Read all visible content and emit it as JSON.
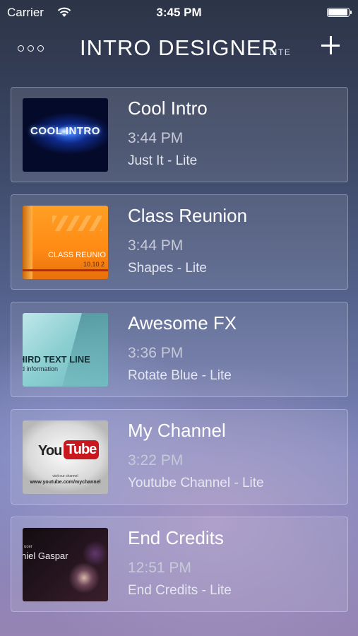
{
  "status_bar": {
    "carrier": "Carrier",
    "time": "3:45 PM",
    "battery_level": 0.95
  },
  "nav": {
    "title": "INTRO DESIGNER",
    "subtitle": "LITE",
    "more_icon": "more-icon",
    "add_icon": "plus-icon"
  },
  "projects": [
    {
      "title": "Cool Intro",
      "time": "3:44 PM",
      "template": "Just It - Lite",
      "thumb_text": "COOL INTRO"
    },
    {
      "title": "Class Reunion",
      "time": "3:44 PM",
      "template": "Shapes - Lite",
      "thumb_text": "CLASS REUNIO",
      "thumb_date": "10.10.2"
    },
    {
      "title": "Awesome FX",
      "time": "3:36 PM",
      "template": "Rotate Blue - Lite",
      "thumb_text": "HIRD TEXT LINE",
      "thumb_sub": "d information"
    },
    {
      "title": "My Channel",
      "time": "3:22 PM",
      "template": "Youtube Channel - Lite",
      "thumb_you": "You",
      "thumb_tube": "Tube",
      "thumb_visit": "visit our channel",
      "thumb_url": "www.youtube.com/mychannel"
    },
    {
      "title": "End Credits",
      "time": "12:51 PM",
      "template": "End Credits - Lite",
      "thumb_small": "ucer",
      "thumb_text": "niel Gaspar"
    }
  ]
}
